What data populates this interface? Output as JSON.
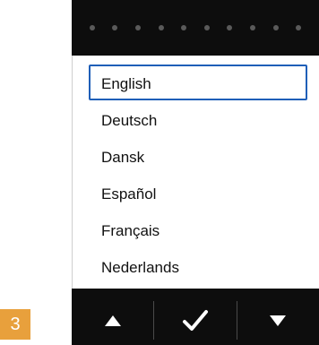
{
  "languages": {
    "items": [
      "English",
      "Deutsch",
      "Dansk",
      "Español",
      "Français",
      "Nederlands"
    ],
    "selected": "English"
  },
  "toolbar": {
    "up_icon": "up-arrow-icon",
    "confirm_icon": "checkmark-icon",
    "down_icon": "down-arrow-icon"
  },
  "step_badge": {
    "label": "3",
    "color": "#e8a03c"
  },
  "colors": {
    "selection_border": "#1f5fb8",
    "device_body": "#0d0d0d"
  }
}
